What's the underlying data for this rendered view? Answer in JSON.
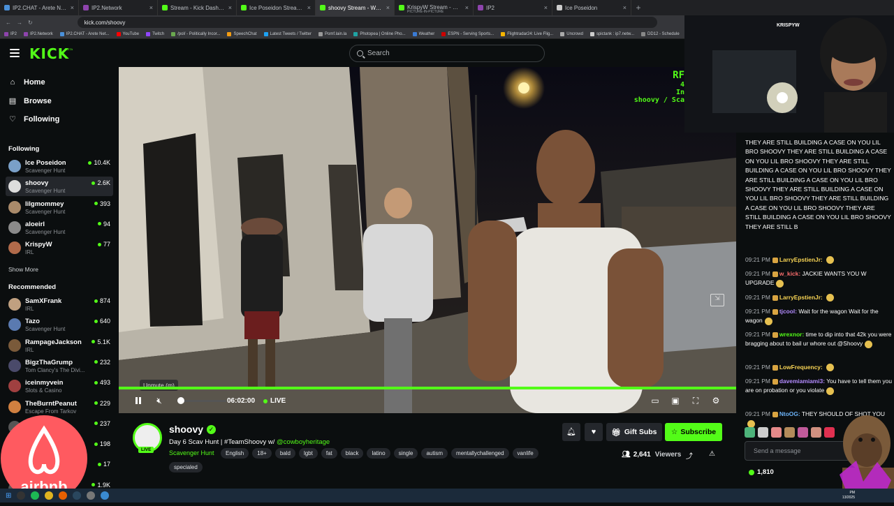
{
  "browser": {
    "tabs": [
      {
        "title": "IP2.CHAT - Arete Network",
        "color": "#4a90d9"
      },
      {
        "title": "IP2.Network",
        "color": "#8e44ad"
      },
      {
        "title": "Stream - Kick Dashboard",
        "color": "#53fc18"
      },
      {
        "title": "Ice Poseidon Stream - Watch Live",
        "color": "#53fc18"
      },
      {
        "title": "shoovy Stream - Watch Live on",
        "color": "#53fc18",
        "active": true
      },
      {
        "title": "KrispyW Stream - Watch Li",
        "subtitle": "PICTURE-IN-PICTURE",
        "color": "#53fc18"
      },
      {
        "title": "IP2",
        "color": "#8e44ad"
      },
      {
        "title": "Ice Poseidon",
        "color": "#cccccc"
      }
    ],
    "new_tab": "+",
    "url": "kick.com/shoovy",
    "bookmarks": [
      "IP2",
      "IP2.Network",
      "IP2.CHAT - Arete Net...",
      "YouTube",
      "Twitch",
      "/pol/ - Politically Incor...",
      "SpeechChat",
      "Latest Tweets / Twitter",
      "Pomf.lain.la",
      "Photopea | Online Pho...",
      "Weather",
      "ESPN - Serving Sports...",
      "Flightradar24: Live Flig...",
      "Uncrowd",
      "spictank : ip7.netw...",
      "DD12 - Schedule",
      "Kick"
    ]
  },
  "header": {
    "logo": "KICK",
    "beta": "BETA",
    "search_placeholder": "Search"
  },
  "sidebar": {
    "nav": [
      {
        "label": "Home",
        "icon": "⌂"
      },
      {
        "label": "Browse",
        "icon": "▤"
      },
      {
        "label": "Following",
        "icon": "♡"
      }
    ],
    "following_title": "Following",
    "following": [
      {
        "name": "Ice Poseidon",
        "category": "Scavenger Hunt",
        "viewers": "10.4K",
        "color": "#7aa0c8"
      },
      {
        "name": "shoovy",
        "category": "Scavenger Hunt",
        "viewers": "2.6K",
        "color": "#dddddd",
        "active": true
      },
      {
        "name": "lilgmommey",
        "category": "Scavenger Hunt",
        "viewers": "393",
        "color": "#a98a6a"
      },
      {
        "name": "aloeirl",
        "category": "Scavenger Hunt",
        "viewers": "94",
        "color": "#8a8a8a"
      },
      {
        "name": "KrispyW",
        "category": "IRL",
        "viewers": "77",
        "color": "#b06a4a"
      }
    ],
    "show_more": "Show More",
    "recommended_title": "Recommended",
    "recommended": [
      {
        "name": "SamXFrank",
        "category": "IRL",
        "viewers": "874",
        "color": "#c0a080"
      },
      {
        "name": "Tazo",
        "category": "Scavenger Hunt",
        "viewers": "640",
        "color": "#5a7ab0"
      },
      {
        "name": "RampageJackson",
        "category": "IRL",
        "viewers": "5.1K",
        "color": "#7a5a3a"
      },
      {
        "name": "BigzThaGrump",
        "category": "Tom Clancy's The Divi...",
        "viewers": "232",
        "color": "#4a4a6a"
      },
      {
        "name": "iceinmyvein",
        "category": "Slots & Casino",
        "viewers": "493",
        "color": "#a04040"
      },
      {
        "name": "TheBurntPeanut",
        "category": "Escape From Tarkov",
        "viewers": "229",
        "color": "#d08040"
      },
      {
        "name": "",
        "category": "",
        "viewers": "237",
        "color": "#555555"
      },
      {
        "name": "",
        "category": "",
        "viewers": "198",
        "color": "#555555"
      },
      {
        "name": "",
        "category": "",
        "viewers": "17",
        "color": "#555555"
      },
      {
        "name": "",
        "category": "",
        "viewers": "1.9K",
        "color": "#555555"
      }
    ]
  },
  "player": {
    "osd_line1": "RF",
    "osd_line2": "4",
    "osd_line3": "In",
    "osd_line4": "shoovy / Sca",
    "tooltip": "Unmute (m)",
    "time": "06:02:00",
    "live": "LIVE",
    "volume": 0
  },
  "channel": {
    "live_badge": "LIVE",
    "name": "shoovy",
    "title_prefix": "Day 6 Scav Hunt | #TeamShoovy w/ ",
    "title_mention": "@cowboyheritage",
    "category": "Scavenger Hunt",
    "tags": [
      "English",
      "18+",
      "bald",
      "lgbt",
      "fat",
      "black",
      "latino",
      "single",
      "autism",
      "mentallychallenged",
      "vanlife"
    ],
    "tags_row2": [
      "specialed"
    ],
    "gift_subs": "Gift Subs",
    "subscribe": "Subscribe",
    "viewers_count": "2,641",
    "viewers_label": "Viewers"
  },
  "chat": {
    "spam": "THEY ARE STILL BUILDING A CASE ON YOU LIL BRO SHOOVY THEY ARE STILL BUILDING A CASE ON YOU LIL BRO SHOOVY THEY ARE STILL BUILDING A CASE ON YOU LIL BRO SHOOVY THEY ARE STILL BUILDING A CASE ON YOU LIL BRO SHOOVY THEY ARE STILL BUILDING A CASE ON YOU LIL BRO SHOOVY THEY ARE STILL BUILDING A CASE ON YOU LIL BRO SHOOVY THEY ARE STILL BUILDING A CASE ON YOU LIL BRO SHOOVY THEY ARE STILL B",
    "messages": [
      {
        "time": "09:21 PM",
        "user": "LarryEpstienJr:",
        "color": "#f7d354",
        "text": ""
      },
      {
        "time": "09:21 PM",
        "user": "w_kick:",
        "color": "#f76b6b",
        "text": "JACKIE WANTS YOU W UPGRADE"
      },
      {
        "time": "09:21 PM",
        "user": "LarryEpstienJr:",
        "color": "#f7d354",
        "text": ""
      },
      {
        "time": "09:21 PM",
        "user": "tjcool:",
        "color": "#b38bff",
        "text": "Wait for the wagon Wait for the wagon"
      },
      {
        "time": "09:21 PM",
        "user": "wrexnor:",
        "color": "#53fc18",
        "text": "time to dip into that 42k you were bragging about to bail ur whore out @Shoovy"
      },
      {
        "time": "09:21 PM",
        "user": "LowFrequency:",
        "color": "#f7d354",
        "text": ""
      },
      {
        "time": "09:21 PM",
        "user": "davemiamiami3:",
        "color": "#b38bff",
        "text": "You have to tell them you are on probation or you violate"
      },
      {
        "time": "09:21 PM",
        "user": "NtoOG:",
        "color": "#6bb2f7",
        "text": "THEY SHOULD OF SHOT YOU"
      }
    ],
    "input_placeholder": "Send a message",
    "points": "1,810"
  },
  "pip": {
    "label": "KRISPYW"
  },
  "overlay": {
    "airbnb_text": "airbnb"
  },
  "taskbar": {
    "clock_line1": "PM",
    "clock_line2": "13/2025"
  }
}
